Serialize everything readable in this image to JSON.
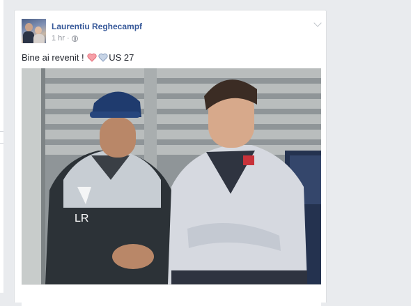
{
  "post": {
    "author": "Laurentiu Reghecampf",
    "time": "1 hr",
    "separator": "·",
    "audience_icon": "globe-icon",
    "options_icon": "chevron-down-icon",
    "text_before": "Bine ai revenit !",
    "emojis": [
      "red-heart-icon",
      "blue-heart-icon"
    ],
    "text_after": "US 27"
  },
  "photo": {
    "subject": "photo-two-men-smiling",
    "jacket_logo": "LR"
  },
  "colors": {
    "background": "#e9ebee",
    "card": "#ffffff",
    "link": "#365899",
    "meta": "#90949c",
    "text": "#1d2129"
  }
}
